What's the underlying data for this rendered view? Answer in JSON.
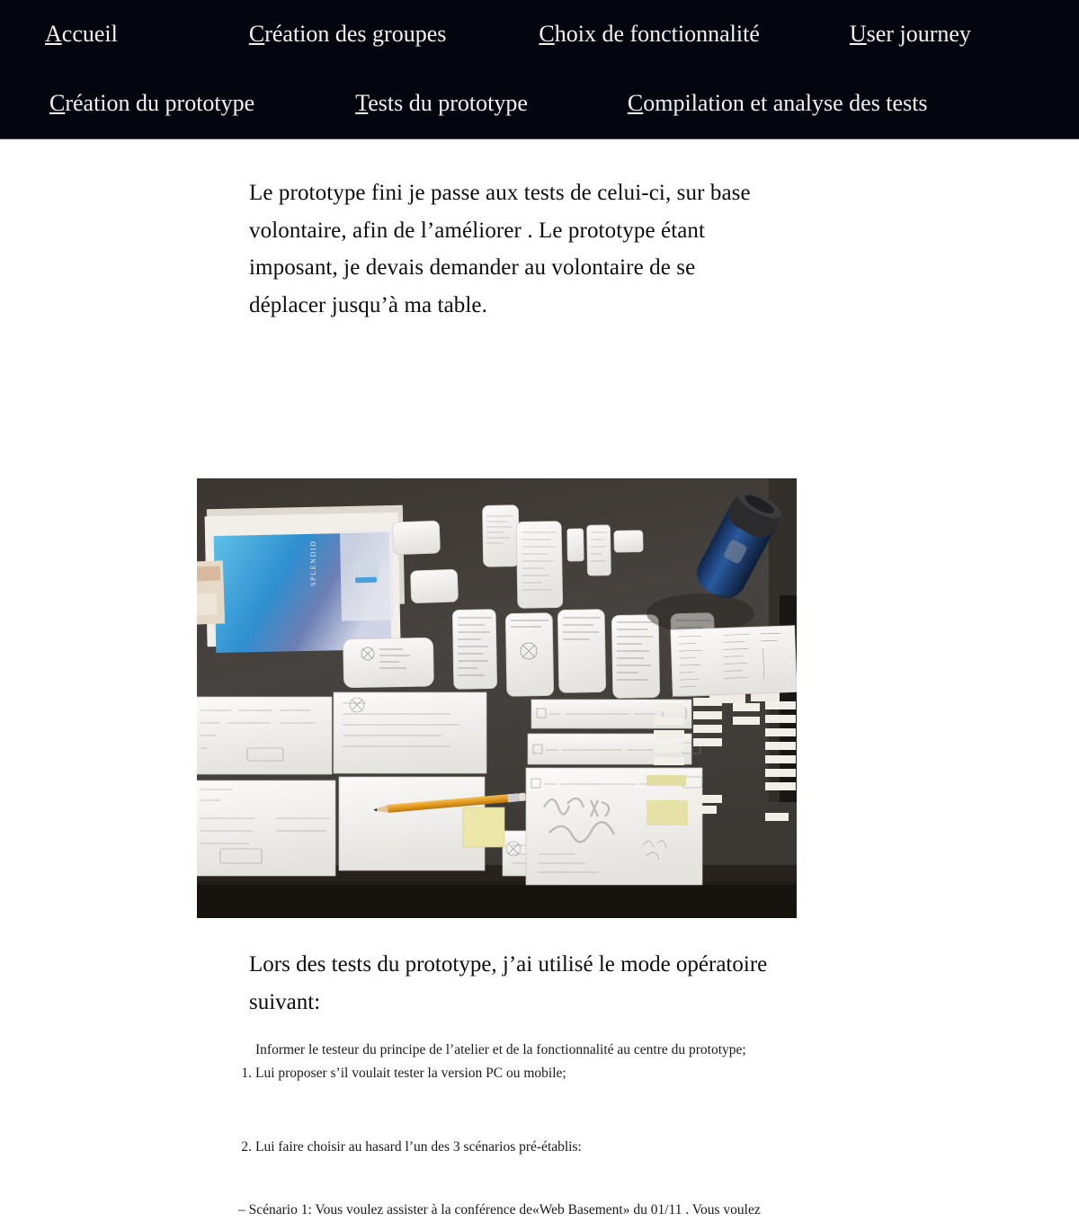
{
  "nav": {
    "rows": [
      [
        {
          "label": "Accueil",
          "accesskey": "A"
        },
        {
          "label": "Création des groupes",
          "accesskey": "C"
        },
        {
          "label": "Choix de fonctionnalité",
          "accesskey": "C"
        },
        {
          "label": "User journey",
          "accesskey": "U"
        }
      ],
      [
        {
          "label": "Création du prototype",
          "accesskey": "C"
        },
        {
          "label": "Tests du prototype",
          "accesskey": "T"
        },
        {
          "label": "Compilation et analyse des tests",
          "accesskey": "C"
        }
      ]
    ]
  },
  "main": {
    "intro_paragraph": "Le prototype fini je passe aux tests de celui-ci, sur base volontaire, afin de l’améliorer . Le prototype étant imposant, je devais demander au volontaire de se déplacer jusqu’à ma table.",
    "photo": {
      "alt": "Photo d’une table avec le prototype papier : feuilles, maquettes d’écrans mobiles, carnet SPLENDID, crayon, post-it et gourde bleue",
      "table_color": "#3f3b38",
      "paper_color": "#f4f2ee",
      "notebook_color": "#2f8fd0",
      "pencil_color": "#e8a12a",
      "postit_color": "#ece6a8",
      "bottle_color": "#1b3f78"
    },
    "mode_paragraph": "Lors des tests du prototype, j’ai utilisé le mode opératoire suivant:",
    "steps": [
      {
        "marker": "",
        "text": "Informer le testeur du principe de l’atelier et de la fonctionnalité au centre du prototype;"
      },
      {
        "marker": "1.",
        "text": "Lui proposer s’il voulait tester la version PC ou mobile;"
      }
    ],
    "steps_after_gap": [
      {
        "marker": "2.",
        "text": "Lui faire choisir au hasard l’un des 3 scénarios pré-établis:"
      }
    ],
    "scenario_line": "– Scénario 1: Vous voulez assister à la conférence de«Web Basement» du 01/11 . Vous voulez"
  }
}
